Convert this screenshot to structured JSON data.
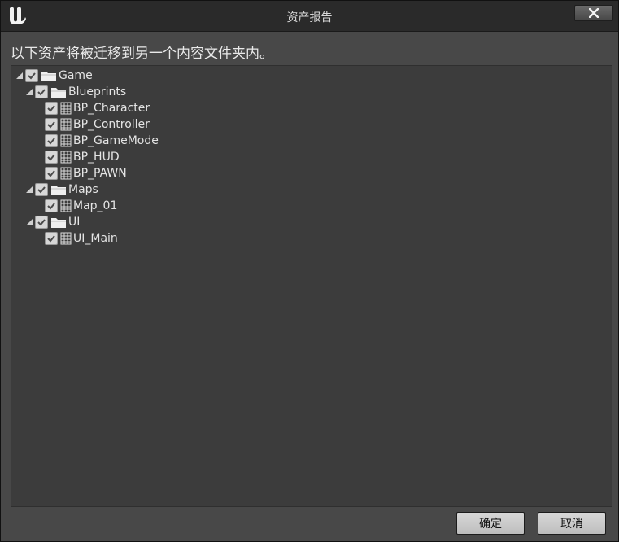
{
  "window": {
    "title": "资产报告",
    "message": "以下资产将被迁移到另一个内容文件夹内。"
  },
  "tree": {
    "game": {
      "label": "Game",
      "checked": true
    },
    "blueprints": {
      "label": "Blueprints",
      "checked": true
    },
    "bp_character": {
      "label": "BP_Character",
      "checked": true
    },
    "bp_controller": {
      "label": "BP_Controller",
      "checked": true
    },
    "bp_gamemode": {
      "label": "BP_GameMode",
      "checked": true
    },
    "bp_hud": {
      "label": "BP_HUD",
      "checked": true
    },
    "bp_pawn": {
      "label": "BP_PAWN",
      "checked": true
    },
    "maps": {
      "label": "Maps",
      "checked": true
    },
    "map_01": {
      "label": "Map_01",
      "checked": true
    },
    "ui": {
      "label": "UI",
      "checked": true
    },
    "ui_main": {
      "label": "UI_Main",
      "checked": true
    }
  },
  "buttons": {
    "ok": "确定",
    "cancel": "取消"
  },
  "icons": {
    "logo": "unreal-logo-icon",
    "close": "close-icon",
    "expand": "expanded-arrow-icon",
    "folder": "folder-icon",
    "asset": "asset-grid-icon",
    "check": "checkmark-icon"
  }
}
